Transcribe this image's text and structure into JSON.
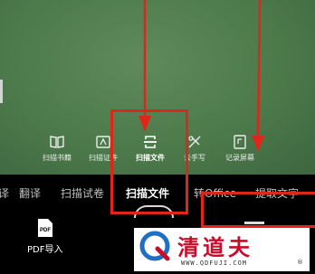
{
  "quick_actions": [
    {
      "label": "扫描书籍",
      "icon": "book-icon"
    },
    {
      "label": "扫描证件",
      "icon": "id-card-icon"
    },
    {
      "label": "扫描文件",
      "icon": "scan-doc-icon",
      "active": true
    },
    {
      "label": "去手写",
      "icon": "erase-handwriting-icon"
    },
    {
      "label": "记录屏幕",
      "icon": "screen-record-icon"
    }
  ],
  "tabs": [
    {
      "label": "译"
    },
    {
      "label": "翻译"
    },
    {
      "label": "扫描试卷"
    },
    {
      "label": "扫描文件",
      "active": true
    },
    {
      "label": "转Office"
    },
    {
      "label": "提取文字"
    }
  ],
  "bottom": {
    "pdf_import_label": "PDF导入",
    "pdf_icon_text": "PDF"
  },
  "watermark": {
    "title": "清道夫",
    "url": "WWW.QDFUJI.COM",
    "registered": "®"
  },
  "colors": {
    "annotation_red": "#e0261b",
    "watermark_red": "#c70d2a",
    "camera_green": "#4d7a4b"
  }
}
